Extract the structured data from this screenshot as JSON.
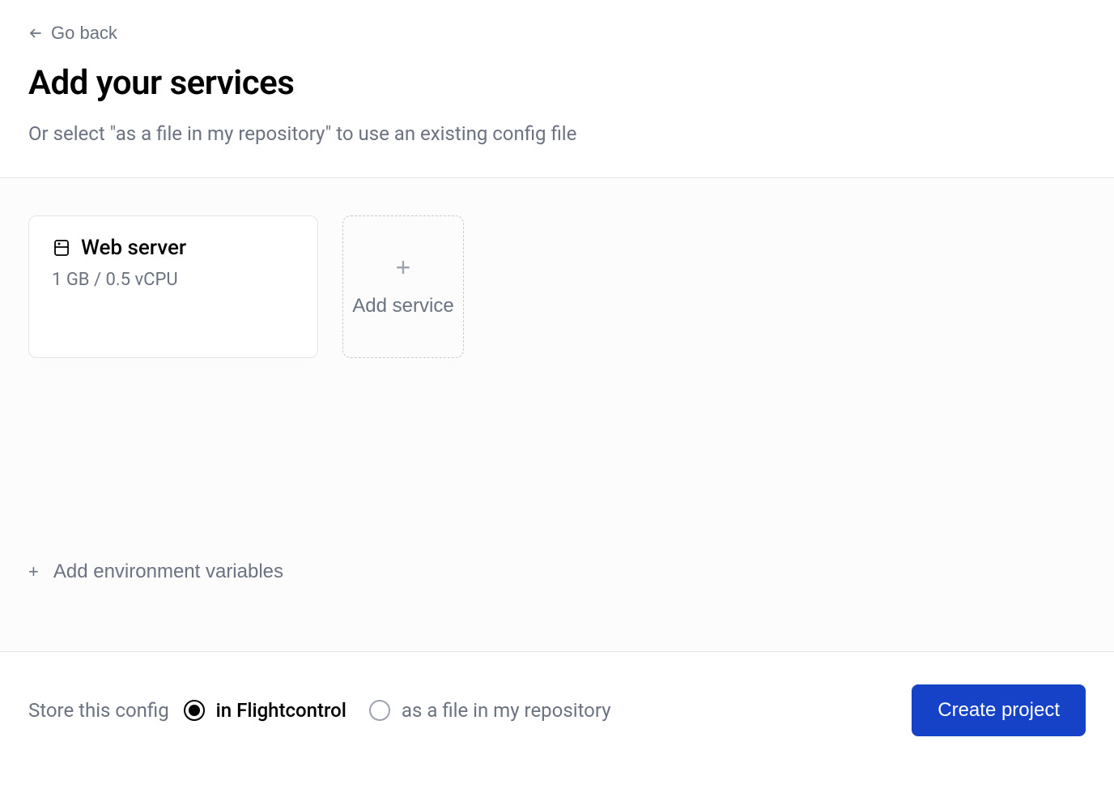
{
  "header": {
    "back_label": "Go back",
    "title": "Add your services",
    "subtitle": "Or select \"as a file in my repository\" to use an existing config file"
  },
  "services": [
    {
      "name": "Web server",
      "spec": "1 GB / 0.5 vCPU"
    }
  ],
  "add_service_label": "Add service",
  "env": {
    "add_label": "Add environment variables"
  },
  "footer": {
    "config_label": "Store this config",
    "option_flightcontrol": "in Flightcontrol",
    "option_file": "as a file in my repository",
    "create_label": "Create project"
  }
}
